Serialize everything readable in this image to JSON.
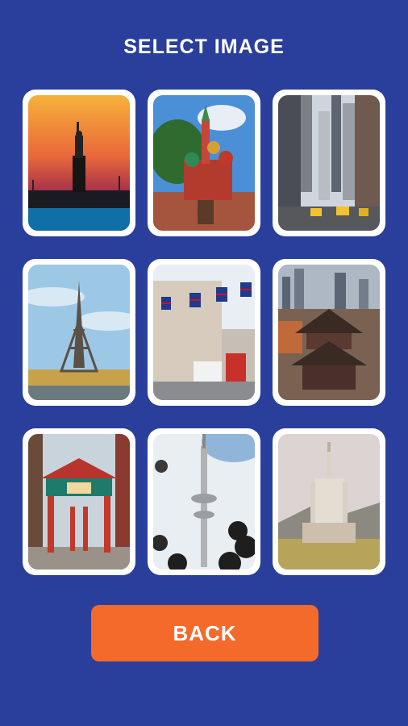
{
  "header": {
    "title": "SELECT IMAGE"
  },
  "images": [
    {
      "name": "statue-of-liberty-image"
    },
    {
      "name": "st-basils-cathedral-image"
    },
    {
      "name": "new-york-street-image"
    },
    {
      "name": "eiffel-tower-image"
    },
    {
      "name": "london-street-image"
    },
    {
      "name": "singapore-temple-image"
    },
    {
      "name": "chinatown-gate-image"
    },
    {
      "name": "hamburg-tower-image"
    },
    {
      "name": "barcelona-tibidabo-image"
    }
  ],
  "footer": {
    "back_label": "BACK"
  },
  "colors": {
    "background": "#2a3f9c",
    "card": "#ffffff",
    "button": "#f36a2b"
  }
}
